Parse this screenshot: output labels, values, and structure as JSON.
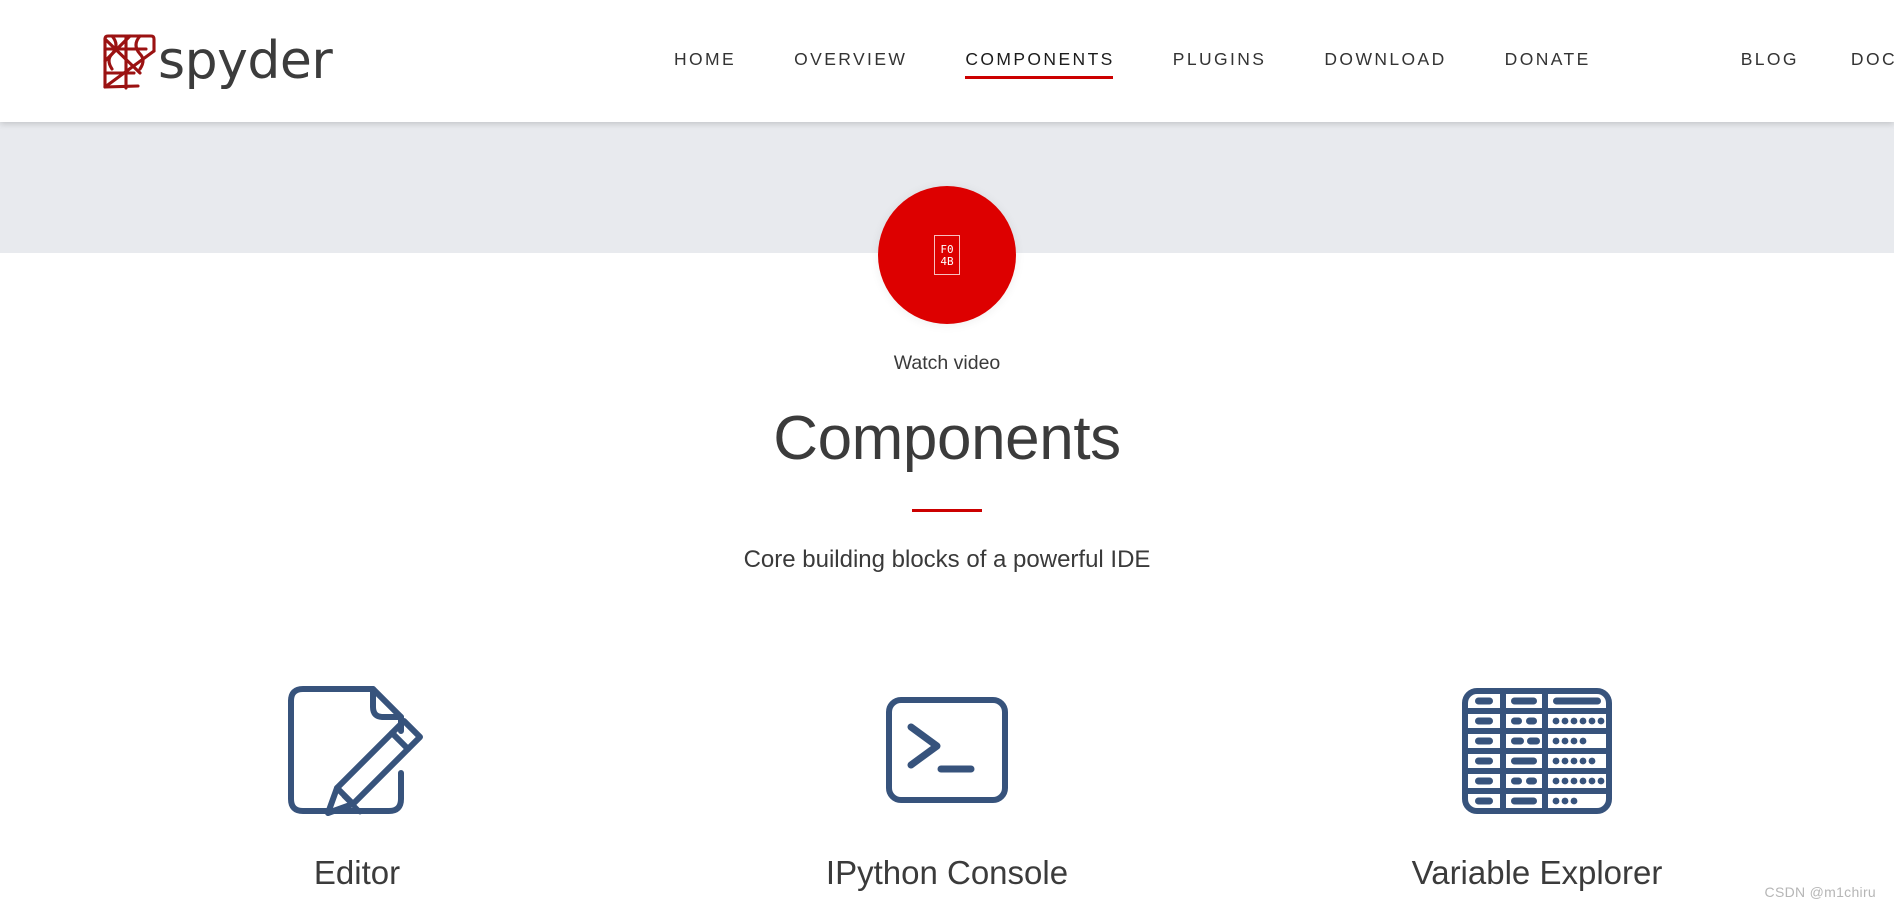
{
  "header": {
    "brand": {
      "logo_icon": "spyder-web-logo-icon",
      "word": "spyder",
      "logo_color": "#9b1212",
      "word_color": "#3c3c3c"
    },
    "nav_primary": [
      {
        "label": "HOME",
        "active": false
      },
      {
        "label": "OVERVIEW",
        "active": false
      },
      {
        "label": "COMPONENTS",
        "active": true
      },
      {
        "label": "PLUGINS",
        "active": false
      },
      {
        "label": "DOWNLOAD",
        "active": false
      },
      {
        "label": "DONATE",
        "active": false
      }
    ],
    "nav_secondary": [
      {
        "label": "BLOG",
        "active": false
      },
      {
        "label": "DOCS",
        "active": false
      }
    ],
    "active_underline_color": "#cc0000"
  },
  "hero": {
    "band_color": "#e8eaee",
    "play_button": {
      "icon": "play-icon",
      "circle_color": "#dd0000",
      "missing_glyph_top": "F0",
      "missing_glyph_bottom": "4B"
    },
    "watch_label": "Watch video"
  },
  "title_block": {
    "title": "Components",
    "rule_color": "#cc0000",
    "subtitle": "Core building blocks of a powerful IDE"
  },
  "features": [
    {
      "label": "Editor",
      "icon": "document-pencil-icon",
      "icon_color": "#37537c"
    },
    {
      "label": "IPython Console",
      "icon": "terminal-prompt-icon",
      "icon_color": "#37537c"
    },
    {
      "label": "Variable Explorer",
      "icon": "data-table-grid-icon",
      "icon_color": "#37537c"
    }
  ],
  "watermark": "CSDN @m1chiru"
}
